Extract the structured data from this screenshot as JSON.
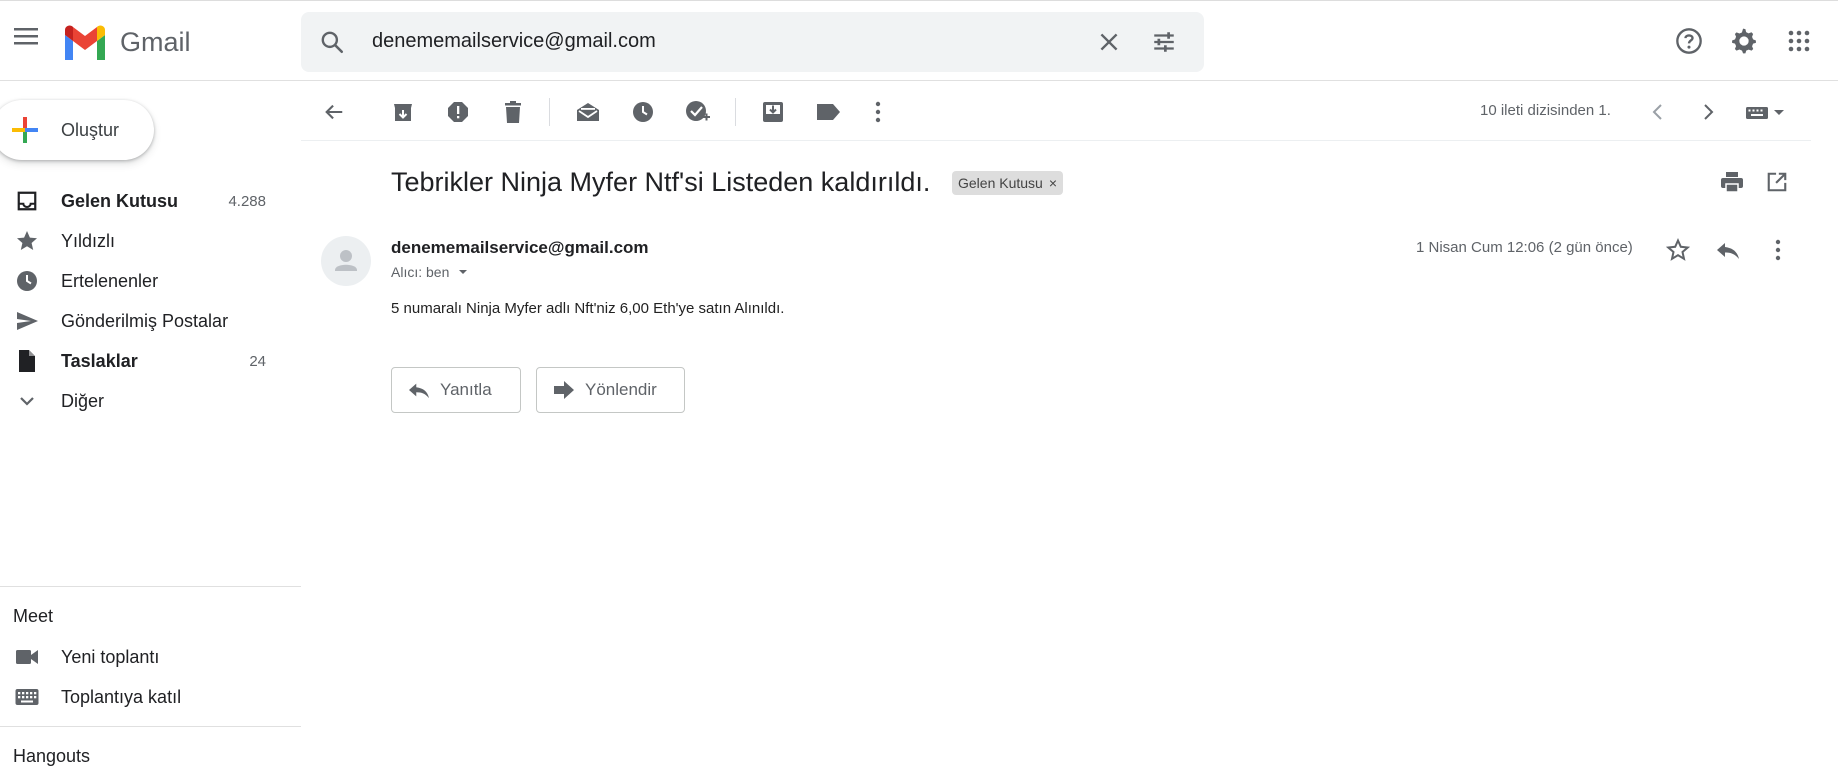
{
  "app": {
    "name": "Gmail"
  },
  "search": {
    "value": "denememailservice@gmail.com"
  },
  "sidebar": {
    "compose_label": "Oluştur",
    "items": [
      {
        "label": "Gelen Kutusu",
        "count": "4.288",
        "bold": true
      },
      {
        "label": "Yıldızlı",
        "count": ""
      },
      {
        "label": "Ertelenenler",
        "count": ""
      },
      {
        "label": "Gönderilmiş Postalar",
        "count": ""
      },
      {
        "label": "Taslaklar",
        "count": "24",
        "bold": true
      },
      {
        "label": "Diğer",
        "count": ""
      }
    ],
    "meet": {
      "title": "Meet",
      "items": [
        {
          "label": "Yeni toplantı"
        },
        {
          "label": "Toplantıya katıl"
        }
      ]
    },
    "hangouts": {
      "title": "Hangouts"
    }
  },
  "toolbar": {
    "pager_text": "10 ileti dizisinden 1."
  },
  "message": {
    "subject": "Tebrikler Ninja Myfer Ntf'si Listeden kaldırıldı.",
    "label_chip": "Gelen Kutusu",
    "sender": "denememailservice@gmail.com",
    "to_line": "Alıcı: ben",
    "date": "1 Nisan Cum 12:06 (2 gün önce)",
    "body": "5 numaralı Ninja Myfer adlı Nft'niz 6,00 Eth'ye satın Alınıldı.",
    "reply_label": "Yanıtla",
    "forward_label": "Yönlendir"
  },
  "colors": {
    "gmail_red": "#EA4335",
    "gmail_blue": "#4285F4",
    "gmail_green": "#34A853",
    "gmail_yellow": "#FBBC04",
    "icon_gray": "#5f6368"
  }
}
